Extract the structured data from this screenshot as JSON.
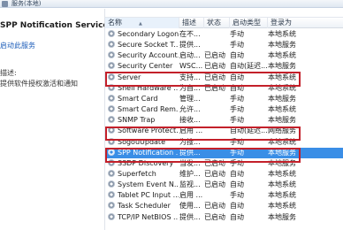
{
  "window": {
    "title": "服务(本地)"
  },
  "detail": {
    "service_name": "SPP Notification Service",
    "start_link": "启动此服务",
    "description_label": "描述:",
    "description_text": "提供软件授权激活和通知"
  },
  "table": {
    "columns": [
      "名称",
      "描述",
      "状态",
      "启动类型",
      "登录为"
    ],
    "sorted_column_index": 0,
    "rows": [
      {
        "name": "Secondary Logon",
        "desc": "在不...",
        "state": "",
        "start": "手动",
        "logon": "本地系统"
      },
      {
        "name": "Secure Socket T...",
        "desc": "提供...",
        "state": "",
        "start": "手动",
        "logon": "本地服务"
      },
      {
        "name": "Security Account...",
        "desc": "启动...",
        "state": "已启动",
        "start": "自动",
        "logon": "本地系统"
      },
      {
        "name": "Security Center",
        "desc": "WSC...",
        "state": "已启动",
        "start": "自动(延迟...",
        "logon": "本地服务"
      },
      {
        "name": "Server",
        "desc": "支持...",
        "state": "已启动",
        "start": "自动",
        "logon": "本地系统"
      },
      {
        "name": "Shell Hardware ...",
        "desc": "为自...",
        "state": "已启动",
        "start": "自动",
        "logon": "本地系统"
      },
      {
        "name": "Smart Card",
        "desc": "管理...",
        "state": "",
        "start": "手动",
        "logon": "本地服务"
      },
      {
        "name": "Smart Card Rem...",
        "desc": "允许...",
        "state": "",
        "start": "手动",
        "logon": "本地系统"
      },
      {
        "name": "SNMP Trap",
        "desc": "接收...",
        "state": "",
        "start": "手动",
        "logon": "本地服务"
      },
      {
        "name": "Software Protect...",
        "desc": "启用 ...",
        "state": "",
        "start": "自动(延迟...",
        "logon": "网络服务"
      },
      {
        "name": "SogouUpdate",
        "desc": "为搜...",
        "state": "",
        "start": "手动",
        "logon": "本地系统"
      },
      {
        "name": "SPP Notification ...",
        "desc": "提供...",
        "state": "",
        "start": "手动",
        "logon": "本地服务"
      },
      {
        "name": "SSDP Discovery",
        "desc": "当发...",
        "state": "已启动",
        "start": "手动",
        "logon": "本地服务"
      },
      {
        "name": "Superfetch",
        "desc": "维护...",
        "state": "已启动",
        "start": "自动",
        "logon": "本地系统"
      },
      {
        "name": "System Event N...",
        "desc": "监视...",
        "state": "已启动",
        "start": "自动",
        "logon": "本地系统"
      },
      {
        "name": "Tablet PC Input ...",
        "desc": "启用 ...",
        "state": "",
        "start": "手动",
        "logon": "本地系统"
      },
      {
        "name": "Task Scheduler",
        "desc": "使用...",
        "state": "已启动",
        "start": "自动",
        "logon": "本地系统"
      },
      {
        "name": "TCP/IP NetBIOS ...",
        "desc": "提供...",
        "state": "已启动",
        "start": "自动",
        "logon": "本地服务"
      }
    ]
  },
  "highlight_color": "#c3202a",
  "selection_color": "#3a8ee6"
}
